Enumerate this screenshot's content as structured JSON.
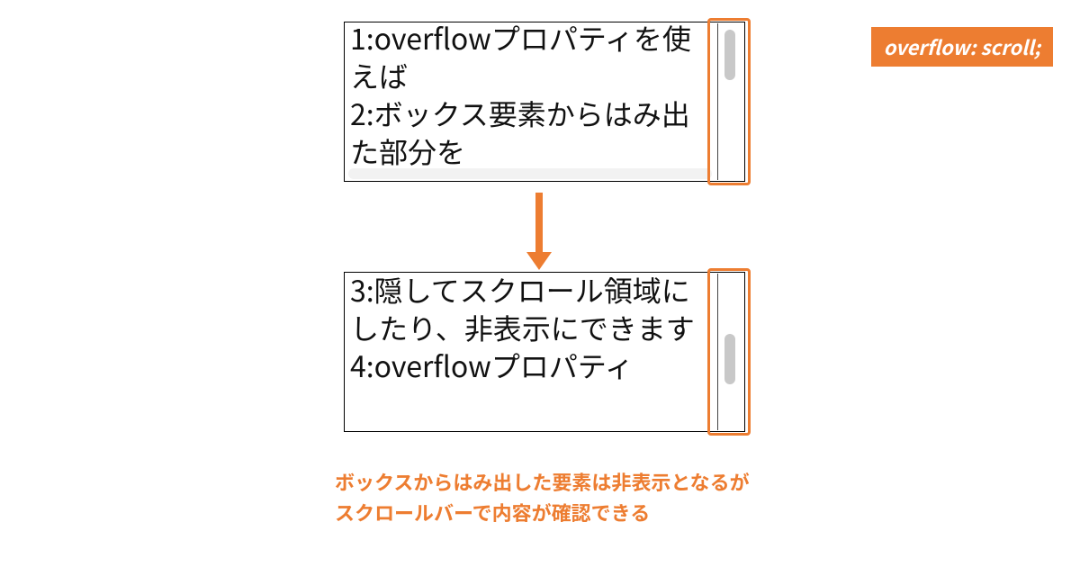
{
  "badge": "overflow: scroll;",
  "box_top_text": "1:overflowプロパティを使えば\n2:ボックス要素からはみ出た部分を",
  "box_bottom_text": "3:隠してスクロール領域にしたり、非表示にできます\n4:overflowプロパティ",
  "caption": "ボックスからはみ出した要素は非表示となるが\nスクロールバーで内容が確認できる",
  "colors": {
    "accent": "#ed7d31"
  }
}
